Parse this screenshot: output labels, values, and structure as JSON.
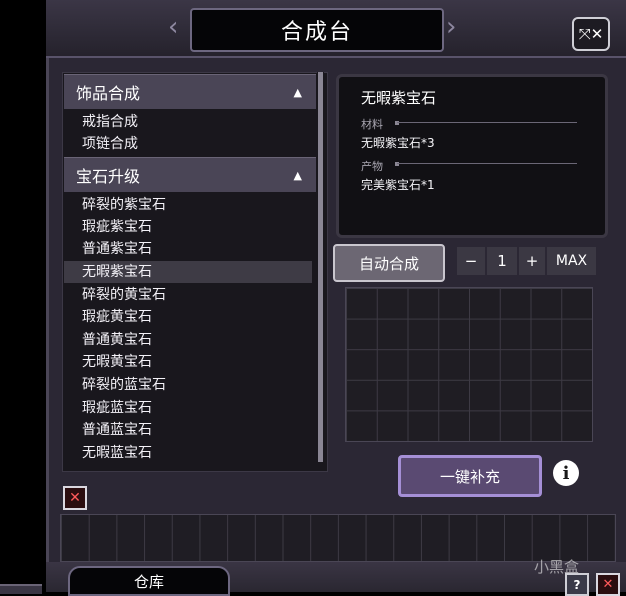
{
  "window": {
    "title": "合成台"
  },
  "categories": [
    {
      "label": "饰品合成",
      "arrow": "▲",
      "items": [
        "戒指合成",
        "项链合成"
      ]
    },
    {
      "label": "宝石升级",
      "arrow": "▲",
      "items": [
        "碎裂的紫宝石",
        "瑕疵紫宝石",
        "普通紫宝石",
        "无暇紫宝石",
        "碎裂的黄宝石",
        "瑕疵黄宝石",
        "普通黄宝石",
        "无暇黄宝石",
        "碎裂的蓝宝石",
        "瑕疵蓝宝石",
        "普通蓝宝石",
        "无暇蓝宝石"
      ]
    }
  ],
  "selected_item": "无暇紫宝石",
  "info": {
    "title": "无暇紫宝石",
    "materials_label": "材料",
    "materials_value": "无暇紫宝石*3",
    "product_label": "产物",
    "product_value": "完美紫宝石*1"
  },
  "controls": {
    "auto_craft": "自动合成",
    "minus": "−",
    "quantity": "1",
    "plus": "+",
    "max": "MAX",
    "fill_all": "一键补充",
    "info_icon": "i"
  },
  "footer": {
    "warehouse_tab": "仓库",
    "help": "?",
    "close": "✕"
  },
  "icons": {
    "close_top": "expand-close-icon",
    "close_small": "close-icon",
    "info": "info-icon"
  },
  "watermark": "小黑盒"
}
